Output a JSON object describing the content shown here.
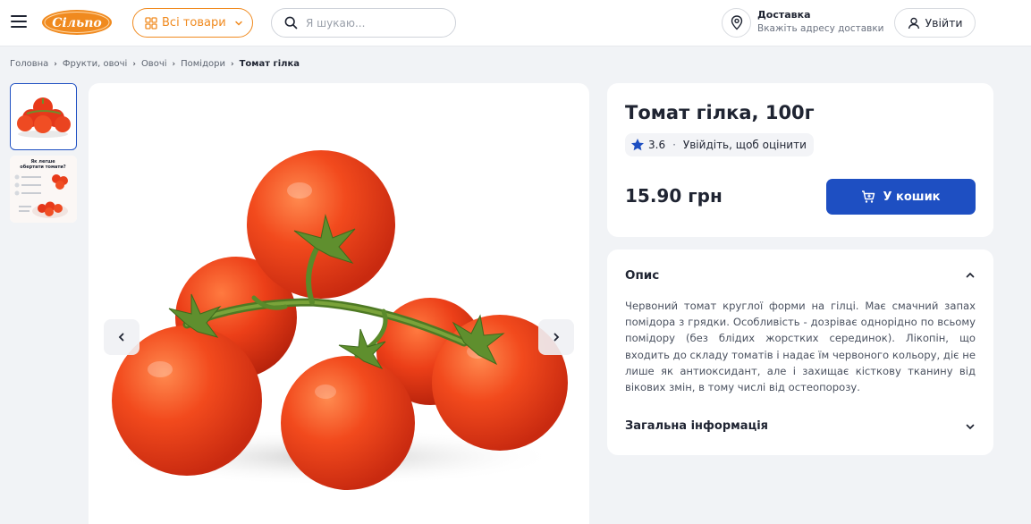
{
  "header": {
    "logo_text": "Сільпо",
    "catalog_label": "Всі товари",
    "search_placeholder": "Я шукаю...",
    "delivery_title": "Доставка",
    "delivery_subtitle": "Вкажіть адресу доставки",
    "login_label": "Увійти",
    "brand_color": "#f08a1f",
    "accent_color": "#1e4fc2"
  },
  "breadcrumb": {
    "items": [
      "Головна",
      "Фрукти, овочі",
      "Овочі",
      "Помідори"
    ],
    "current": "Томат гілка"
  },
  "thumbnails": {
    "thumb2_title": "Як легше обертати томати?"
  },
  "product": {
    "title": "Томат гілка, 100г",
    "rating": "3.6",
    "rating_cta": "Увійдіть, щоб оцінити",
    "price": "15.90 грн",
    "cart_label": "У кошик"
  },
  "description": {
    "heading": "Опис",
    "text": "Червоний томат круглої форми на гілці. Має смачний запах помідора з грядки. Особливість - дозріває однорідно по всьому помідору (без блідих жорстких серединок). Лікопін, що входить до складу томатів і надає їм червоного кольору, діє не лише як антиоксидант, але і захищає кісткову тканину від вікових змін, в тому числі від остеопорозу.",
    "general_heading": "Загальна інформація"
  },
  "icons": {
    "menu": "menu-icon",
    "grid": "grid-icon",
    "search": "search-icon",
    "location": "location-pin-icon",
    "user": "user-icon",
    "star": "star-icon",
    "cart": "cart-icon"
  }
}
